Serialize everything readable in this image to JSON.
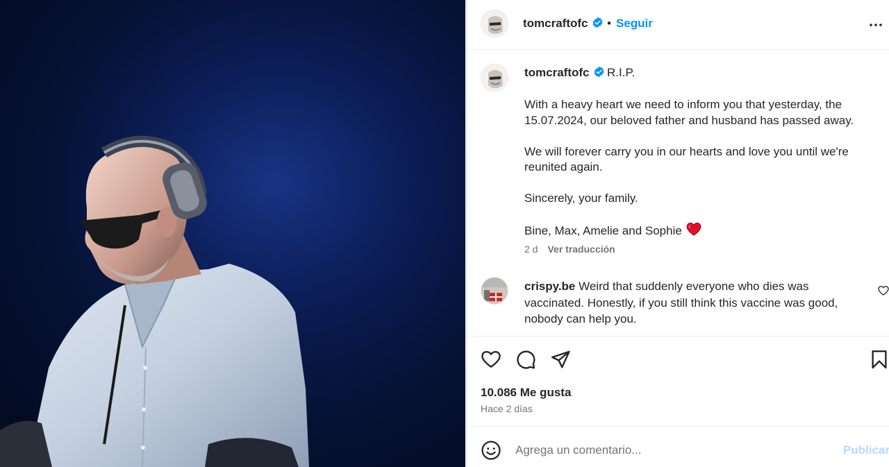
{
  "post": {
    "username": "tomcraftofc",
    "follow_label": "Seguir",
    "separator": "•",
    "caption": {
      "title": "R.I.P.",
      "paragraphs": [
        "With a heavy heart we need to inform you that yesterday, the 15.07.2024, our beloved father and husband has passed away.",
        "We will forever carry you in our hearts and love you until we're reunited again.",
        "Sincerely, your family.",
        "Bine, Max, Amelie and Sophie"
      ],
      "age": "2 d",
      "translate_label": "Ver traducción"
    },
    "comments": [
      {
        "username": "crispy.be",
        "text": "Weird that suddenly everyone who dies was vaccinated. Honestly, if you still think this vaccine was good, nobody can help you."
      }
    ],
    "likes": "10.086 Me gusta",
    "time": "Hace 2 días"
  },
  "composer": {
    "placeholder": "Agrega un comentario...",
    "publish_label": "Publicar"
  },
  "colors": {
    "accent": "#0095f6",
    "verified": "#0095f6",
    "muted": "#737373",
    "publish_disabled": "#b3dbff",
    "heart_emoji": "#e0112b"
  },
  "icons": [
    "verified-badge-icon",
    "more-options-icon",
    "heart-icon",
    "comment-icon",
    "share-icon",
    "bookmark-icon",
    "emoji-icon",
    "small-heart-icon"
  ]
}
